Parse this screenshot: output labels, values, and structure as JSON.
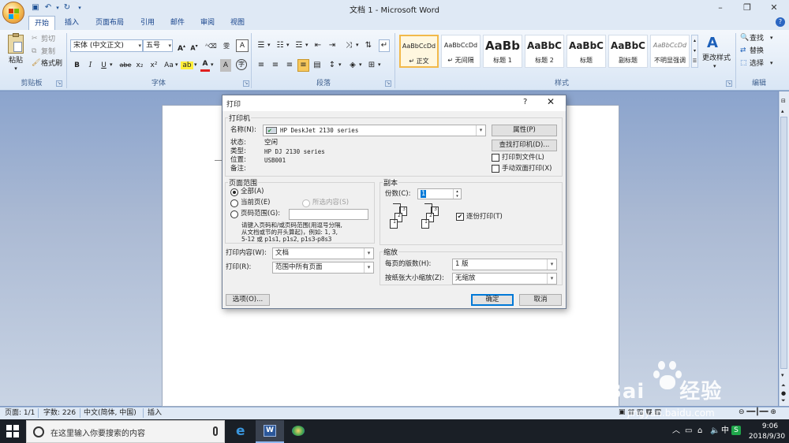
{
  "window": {
    "title": "文档 1 - Microsoft Word",
    "controls": [
      "–",
      "❐",
      "✕"
    ]
  },
  "ribbon": {
    "tabs": [
      "开始",
      "插入",
      "页面布局",
      "引用",
      "邮件",
      "审阅",
      "视图"
    ],
    "clipboard": {
      "paste": "粘贴",
      "cut": "剪切",
      "copy": "复制",
      "format_painter": "格式刷",
      "label": "剪贴板"
    },
    "font": {
      "font_name": "宋体 (中文正文)",
      "font_size": "五号",
      "label": "字体",
      "buttons": [
        "B",
        "I",
        "U",
        "abe",
        "x₂",
        "x²",
        "Aa"
      ]
    },
    "paragraph": {
      "label": "段落"
    },
    "styles": {
      "label": "样式",
      "tiles": [
        {
          "sample": "AaBbCcDd",
          "name": "↵ 正文"
        },
        {
          "sample": "AaBbCcDd",
          "name": "↵ 无间隔"
        },
        {
          "sample": "AaBb",
          "name": "标题 1"
        },
        {
          "sample": "AaBbC",
          "name": "标题 2"
        },
        {
          "sample": "AaBbC",
          "name": "标题"
        },
        {
          "sample": "AaBbC",
          "name": "副标题"
        },
        {
          "sample": "AaBbCcDd",
          "name": "不明显强调"
        }
      ],
      "change_styles": "更改样式"
    },
    "editing": {
      "label": "编辑",
      "find": "查找",
      "replace": "替换",
      "select": "选择"
    }
  },
  "print_dialog": {
    "title": "打印",
    "help": "?",
    "close": "✕",
    "printer": {
      "section": "打印机",
      "name_label": "名称(N):",
      "name_value": "HP DeskJet 2130 series",
      "status_label": "状态:",
      "status_value": "空闲",
      "type_label": "类型:",
      "type_value": "HP DJ 2130 series",
      "where_label": "位置:",
      "where_value": "USB001",
      "comment_label": "备注:",
      "properties": "属性(P)",
      "find_printer": "查找打印机(D)...",
      "print_to_file": "打印到文件(L)",
      "manual_duplex": "手动双面打印(X)"
    },
    "page_range": {
      "section": "页面范围",
      "all": "全部(A)",
      "current": "当前页(E)",
      "selection": "所选内容(S)",
      "pages": "页码范围(G):",
      "hint": "请键入页码和/或页码范围(用逗号分隔，从文档或节的开头算起)，例如: 1, 3, 5-12 或 p1s1, p1s2, p1s3-p8s3",
      "hint_lines": [
        "请键入页码和/或页码范围(用逗号分隔,",
        "从文档或节的开头算起)，例如: 1, 3,",
        "5-12 或 p1s1, p1s2, p1s3-p8s3"
      ]
    },
    "print_what_label": "打印内容(W):",
    "print_what_value": "文档",
    "print_label": "打印(R):",
    "print_value": "范围中所有页面",
    "copies": {
      "section": "副本",
      "count_label": "份数(C):",
      "count_value": "1",
      "collate": "逐份打印(T)"
    },
    "zoom": {
      "section": "缩放",
      "pages_per_sheet_label": "每页的版数(H):",
      "pages_per_sheet_value": "1 版",
      "scale_label": "按纸张大小缩放(Z):",
      "scale_value": "无缩放"
    },
    "options": "选项(O)...",
    "ok": "确定",
    "cancel": "取消"
  },
  "statusbar": {
    "page": "页面: 1/1",
    "words": "字数: 226",
    "language": "中文(简体, 中国)",
    "mode": "插入"
  },
  "taskbar": {
    "search_placeholder": "在这里输入你要搜索的内容",
    "time": "9:06",
    "date": "2018/9/30"
  },
  "watermark": {
    "brand": "Bai",
    "brand_suffix": "经验",
    "url": "jingyan.baidu.com"
  }
}
